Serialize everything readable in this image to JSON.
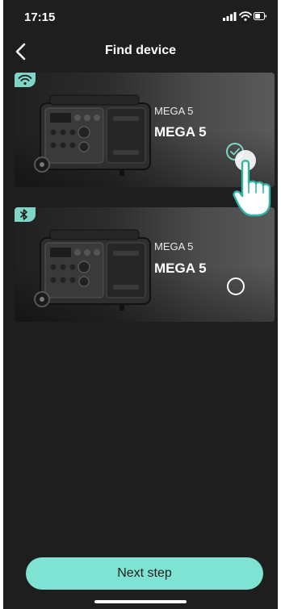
{
  "status_bar": {
    "time": "17:15",
    "icons": [
      "signal-icon",
      "wifi-icon",
      "battery-icon"
    ]
  },
  "nav": {
    "back_icon": "chevron-left-icon",
    "title": "Find device"
  },
  "devices": [
    {
      "connection": "wifi",
      "connection_icon": "wifi-icon",
      "model": "MEGA 5",
      "name": "MEGA 5",
      "selected": true
    },
    {
      "connection": "bluetooth",
      "connection_icon": "bluetooth-icon",
      "model": "MEGA 5",
      "name": "MEGA 5",
      "selected": false
    }
  ],
  "footer": {
    "next_label": "Next step"
  },
  "colors": {
    "background": "#1e1e1e",
    "accent": "#7fd6c7",
    "button": "#7fe3d3",
    "text": "#ffffff"
  }
}
